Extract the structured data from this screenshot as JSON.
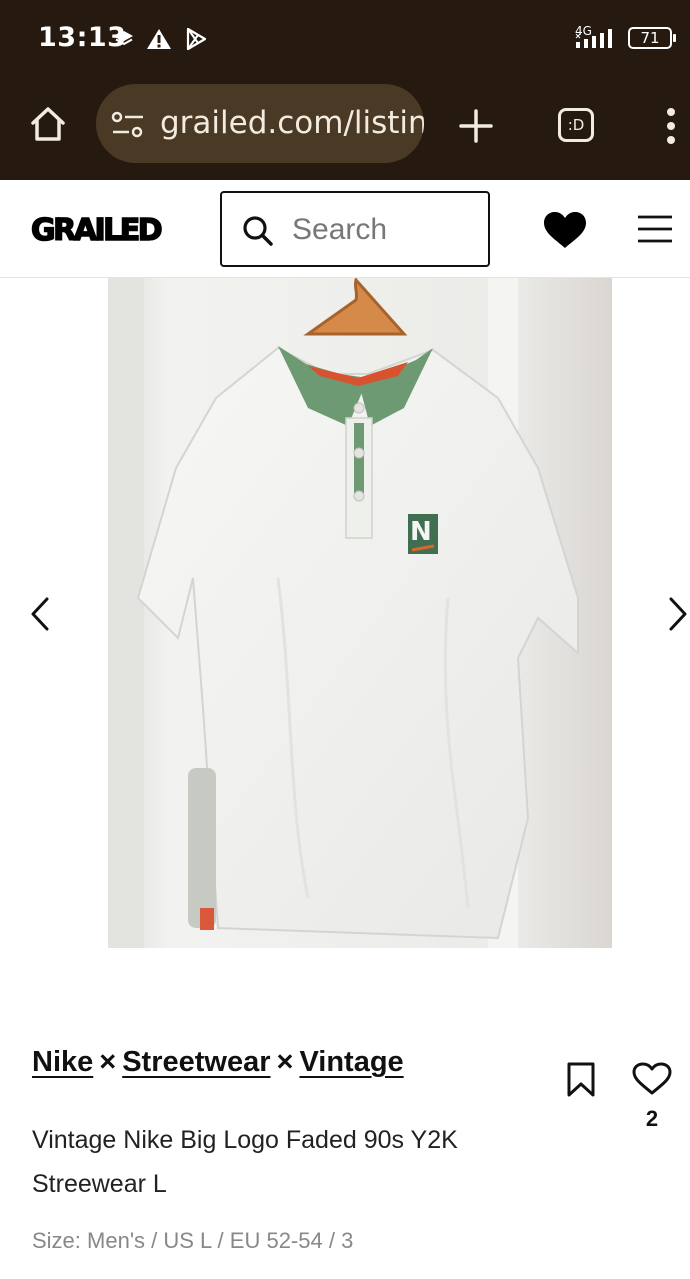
{
  "status_bar": {
    "time": "13:13",
    "network": "4G",
    "battery": "71",
    "icons": [
      "layers-icon",
      "warning-icon",
      "play-store-icon",
      "signal-icon",
      "battery-icon"
    ]
  },
  "browser": {
    "url": "grailed.com/listin",
    "tab_count": ":D",
    "icons": [
      "home-icon",
      "site-settings-icon",
      "plus-icon",
      "more-vert-icon"
    ]
  },
  "site_header": {
    "logo": "GRAILED",
    "search_placeholder": "Search",
    "icons": [
      "search-icon",
      "heart-filled-icon",
      "hamburger-menu-icon"
    ]
  },
  "gallery": {
    "icons": [
      "chevron-left-icon",
      "chevron-right-icon"
    ]
  },
  "listing": {
    "brands": [
      "Nike",
      "Streetwear",
      "Vintage"
    ],
    "brand_separator": "×",
    "title": "Vintage Nike Big Logo Faded 90s Y2K Streewear L",
    "size": "Size: Men's / US L / EU 52-54 / 3",
    "like_count": "2",
    "icons": [
      "bookmark-icon",
      "heart-outline-icon"
    ]
  },
  "colors": {
    "chrome_bg": "#261a10",
    "url_bg": "#4a3a25",
    "collar_green": "#6e9a73"
  }
}
